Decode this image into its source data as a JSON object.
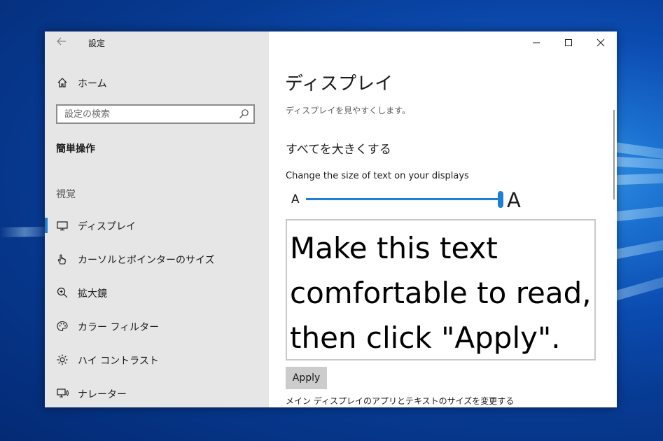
{
  "window": {
    "title": "設定",
    "back_icon": "back-arrow-icon",
    "controls": [
      "minimize-icon",
      "maximize-icon",
      "close-icon"
    ]
  },
  "sidebar": {
    "home": {
      "label": "ホーム",
      "icon": "home-icon"
    },
    "search": {
      "placeholder": "設定の検索",
      "value": "",
      "icon": "search-icon"
    },
    "section_title": "簡単操作",
    "group_label": "視覚",
    "items": [
      {
        "label": "ディスプレイ",
        "icon": "monitor-icon",
        "active": true
      },
      {
        "label": "カーソルとポインターのサイズ",
        "icon": "pointer-hand-icon",
        "active": false
      },
      {
        "label": "拡大鏡",
        "icon": "magnifier-icon",
        "active": false
      },
      {
        "label": "カラー フィルター",
        "icon": "palette-icon",
        "active": false
      },
      {
        "label": "ハイ コントラスト",
        "icon": "brightness-icon",
        "active": false
      },
      {
        "label": "ナレーター",
        "icon": "narrator-icon",
        "active": false
      }
    ]
  },
  "main": {
    "title": "ディスプレイ",
    "description": "ディスプレイを見やすくします。",
    "section_heading": "すべてを大きくする",
    "slider": {
      "label": "Change the size of text on your displays",
      "min_glyph": "A",
      "max_glyph": "A",
      "value_fraction": 1.0
    },
    "preview_text": "Make this text comfortable to read, then click \"Apply\".",
    "apply_label": "Apply",
    "bottom_text": "メイン ディスプレイのアプリとテキストのサイズを変更する"
  },
  "colors": {
    "accent": "#1f7fd1",
    "sidebar_bg": "#e6e6e6",
    "button_bg": "#cccccc"
  }
}
